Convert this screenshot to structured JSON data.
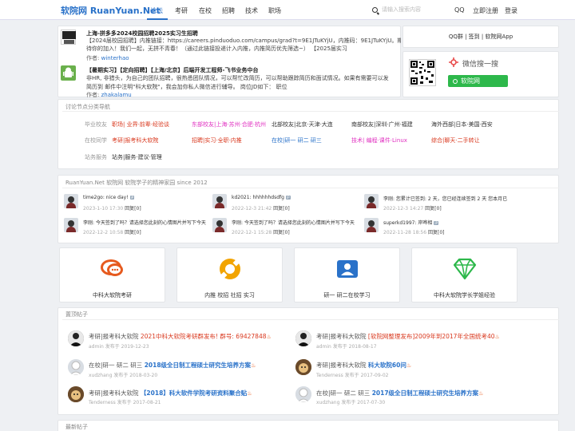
{
  "header": {
    "logo": "软院网 RuanYuan.Net",
    "nav": [
      "论坛",
      "考研",
      "在校",
      "招聘",
      "技术",
      "职场"
    ],
    "search_placeholder": "请输入搜索内容",
    "right_links": [
      "QQ",
      "立即注册",
      "登录"
    ]
  },
  "news": [
    {
      "title": "上海-拼多多2024校园招聘2025实习生招聘",
      "lines": [
        "【2024届校园招聘】内推链接：https://careers.pinduoduo.com/campus/grad?t=9E1JTuKYjU，内推码：9E1JTuKYjU。期",
        "待你的加入！我们一起，无拼不青春！（通过此链接投递计入内推，内推简历优先筛选~） 【2025届实习"
      ],
      "author_label": "作者:",
      "author": "winterhao"
    },
    {
      "title": "【暑期实习】【定向招聘】【上海/北京】后端开发工程师-飞书业务中台",
      "lines": [
        "非HR, 非猎头，为自己的团队招聘，很热悉团队情况，可以帮忙改简历，可以帮助跟踪简历和面试情况。如果有需要可以发",
        "简历到 邮件中注明\"科大软院\"，我会加你私人微信进行辅导。 岗位JD如下： 职位"
      ],
      "author_label": "作者:",
      "author": "zhakalamu"
    }
  ],
  "side": {
    "links": "QQ群 | 签到 | 软院网App",
    "wechat_label": "微信搜一搜",
    "wechat_name": "软院网"
  },
  "categories": {
    "heading": "讨论节点分类导航",
    "rows": [
      {
        "label": "毕业校友",
        "groups": [
          {
            "text": "职场| 业界·前辈·经验谈",
            "color": "#d9381e"
          },
          {
            "text": "东部校友|上海·苏州·合肥·杭州",
            "color": "#e030c0"
          },
          {
            "text": "北部校友|北京·天津·大连",
            "color": "#333333"
          },
          {
            "text": "南部校友|深圳·广州·福建",
            "color": "#333333"
          },
          {
            "text": "海外西部|日本·美国·西安",
            "color": "#333333"
          }
        ]
      },
      {
        "label": "在校同学",
        "groups": [
          {
            "text": "考研|报考科大软院",
            "color": "#d9381e"
          },
          {
            "text": "招聘|实习·全职·内推",
            "color": "#d9381e"
          },
          {
            "text": "在校|研一 研二 研三",
            "color": "#2a72c9"
          },
          {
            "text": "技术| 编程·课件·Linux",
            "color": "#e030c0"
          },
          {
            "text": "综合|聊天·二手转让",
            "color": "#d9381e"
          }
        ]
      },
      {
        "label": "站务服务",
        "groups": [
          {
            "text": "站务|服务·建议·管理",
            "color": "#333333"
          }
        ]
      }
    ]
  },
  "shout": {
    "heading": "RuanYuan.Net 软院网 软院学子的精神家园 since 2012",
    "items": [
      {
        "text": "time2go: nice day!",
        "badge": "iP",
        "time": "2023-1-10 17:30",
        "tail": "回复[0]"
      },
      {
        "text": "kd2021: hhhhhhdsdfg",
        "badge": "iP",
        "time": "2022-12-3 21:42",
        "tail": "回复[0]"
      },
      {
        "text": "李刚: 您累计已签到: 2 天，您已经连续签到 2 天 您本月已",
        "badge": "",
        "time": "2022-12-3 14:27",
        "tail": "回复[0]"
      },
      {
        "text": "李刚: 今天签到了吗？请选择您此刻的心情图片并写下今天",
        "badge": "",
        "time": "2022-12-2 10:58",
        "tail": "回复[0]"
      },
      {
        "text": "李刚: 今天签到了吗？请选择您此刻的心情图片并写下今天",
        "badge": "",
        "time": "2022-12-1 15:28",
        "tail": "回复[0]"
      },
      {
        "text": "superkd1997: 岸晔相",
        "badge": "iP",
        "time": "2022-11-28 18:56",
        "tail": "回复[0]"
      }
    ]
  },
  "cards": [
    {
      "label": "中科大软院考研",
      "icon": "chat-icon",
      "color": "#e65a1e"
    },
    {
      "label": "内推 校招 社招 实习",
      "icon": "lifebuoy-icon",
      "color": "#f2a400"
    },
    {
      "label": "研一 研二在校学习",
      "icon": "user-card-icon",
      "color": "#2a72c9"
    },
    {
      "label": "中科大软院学长学姐经验",
      "icon": "diamond-icon",
      "color": "#2db84b"
    }
  ],
  "pinned": {
    "heading": "置顶帖子",
    "items": [
      {
        "prefix": "考研|报考科大软院",
        "title": "2021中科大软院考研群发布! 群号: 69427848",
        "color": "#d9381e",
        "author": "admin",
        "date": "2019-12-23"
      },
      {
        "prefix": "考研|报考科大软院",
        "title": "[软院网整理发布]2009年到2017年全国统考40",
        "color": "#d9381e",
        "author": "admin",
        "date": "2018-08-17"
      },
      {
        "prefix": "在校|研一 研二 研三",
        "title": "2018级全日制工程硕士研究生培养方案",
        "color": "#2a72c9",
        "author": "xudzhang",
        "date": "2018-03-20"
      },
      {
        "prefix": "考研|报考科大软院",
        "title": "科大软院60问",
        "color": "#2a72c9",
        "author": "Tenderness",
        "date": "2017-09-02"
      },
      {
        "prefix": "考研|报考科大软院",
        "title": "【2018】科大软件学院考研资料聚合贴",
        "color": "#2a72c9",
        "author": "Tenderness",
        "date": "2017-08-21"
      },
      {
        "prefix": "在校|研一 研二 研三",
        "title": "2017级全日制工程硕士研究生培养方案",
        "color": "#2a72c9",
        "author": "xudzhang",
        "date": "2017-07-30"
      }
    ],
    "posted": "发布于"
  },
  "latest": {
    "heading": "最新帖子"
  }
}
